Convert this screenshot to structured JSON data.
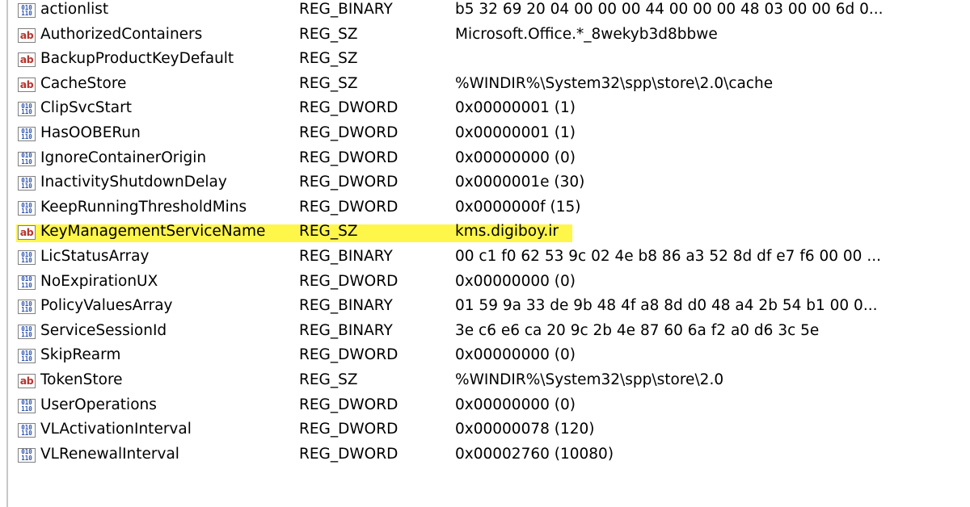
{
  "colors": {
    "highlight": "#fff64a",
    "string_icon": "#b7352e",
    "binary_icon": "#2a52b0"
  },
  "icons": {
    "REG_SZ": "string-value-icon",
    "REG_BINARY": "binary-value-icon",
    "REG_DWORD": "binary-value-icon"
  },
  "icon_glyphs": {
    "sz": "ab",
    "bin_top": "010",
    "bin_bottom": "110"
  },
  "rows": [
    {
      "name": "actionlist",
      "type": "REG_BINARY",
      "data": "b5 32 69 20 04 00 00 00 44 00 00 00 48 03 00 00 6d 0..."
    },
    {
      "name": "AuthorizedContainers",
      "type": "REG_SZ",
      "data": "Microsoft.Office.*_8wekyb3d8bbwe"
    },
    {
      "name": "BackupProductKeyDefault",
      "type": "REG_SZ",
      "data": ""
    },
    {
      "name": "CacheStore",
      "type": "REG_SZ",
      "data": "%WINDIR%\\System32\\spp\\store\\2.0\\cache"
    },
    {
      "name": "ClipSvcStart",
      "type": "REG_DWORD",
      "data": "0x00000001 (1)"
    },
    {
      "name": "HasOOBERun",
      "type": "REG_DWORD",
      "data": "0x00000001 (1)"
    },
    {
      "name": "IgnoreContainerOrigin",
      "type": "REG_DWORD",
      "data": "0x00000000 (0)"
    },
    {
      "name": "InactivityShutdownDelay",
      "type": "REG_DWORD",
      "data": "0x0000001e (30)"
    },
    {
      "name": "KeepRunningThresholdMins",
      "type": "REG_DWORD",
      "data": "0x0000000f (15)"
    },
    {
      "name": "KeyManagementServiceName",
      "type": "REG_SZ",
      "data": "kms.digiboy.ir",
      "highlighted": true
    },
    {
      "name": "LicStatusArray",
      "type": "REG_BINARY",
      "data": "00 c1 f0 62 53 9c 02 4e b8 86 a3 52 8d df e7 f6 00 00 ..."
    },
    {
      "name": "NoExpirationUX",
      "type": "REG_DWORD",
      "data": "0x00000000 (0)"
    },
    {
      "name": "PolicyValuesArray",
      "type": "REG_BINARY",
      "data": "01 59 9a 33 de 9b 48 4f a8 8d d0 48 a4 2b 54 b1 00 0..."
    },
    {
      "name": "ServiceSessionId",
      "type": "REG_BINARY",
      "data": "3e c6 e6 ca 20 9c 2b 4e 87 60 6a f2 a0 d6 3c 5e"
    },
    {
      "name": "SkipRearm",
      "type": "REG_DWORD",
      "data": "0x00000000 (0)"
    },
    {
      "name": "TokenStore",
      "type": "REG_SZ",
      "data": "%WINDIR%\\System32\\spp\\store\\2.0"
    },
    {
      "name": "UserOperations",
      "type": "REG_DWORD",
      "data": "0x00000000 (0)"
    },
    {
      "name": "VLActivationInterval",
      "type": "REG_DWORD",
      "data": "0x00000078 (120)"
    },
    {
      "name": "VLRenewalInterval",
      "type": "REG_DWORD",
      "data": "0x00002760 (10080)"
    }
  ]
}
